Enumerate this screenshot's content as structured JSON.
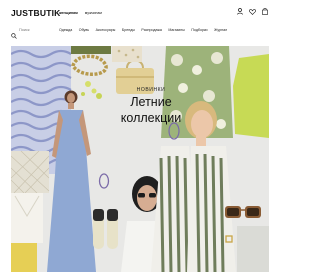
{
  "brand": {
    "logo_text": "JUSTBUTIK"
  },
  "audience_tabs": [
    {
      "label": "женщинам",
      "active": true
    },
    {
      "label": "мужчинам",
      "active": false
    }
  ],
  "header_icons": [
    "user-icon",
    "heart-icon",
    "bag-icon"
  ],
  "search": {
    "placeholder": "Поиск"
  },
  "categories": [
    "Одежда",
    "Обувь",
    "Аксессуары",
    "Бренды",
    "Распродажа",
    "Магазины",
    "Подборки",
    "Журнал"
  ],
  "hero": {
    "eyebrow": "НОВИНКИ",
    "headline_line1": "Летние",
    "headline_line2": "коллекции"
  },
  "colors": {
    "accent_lime": "#c7da55",
    "hero_bg": "#e8e8e6",
    "text": "#111111"
  }
}
